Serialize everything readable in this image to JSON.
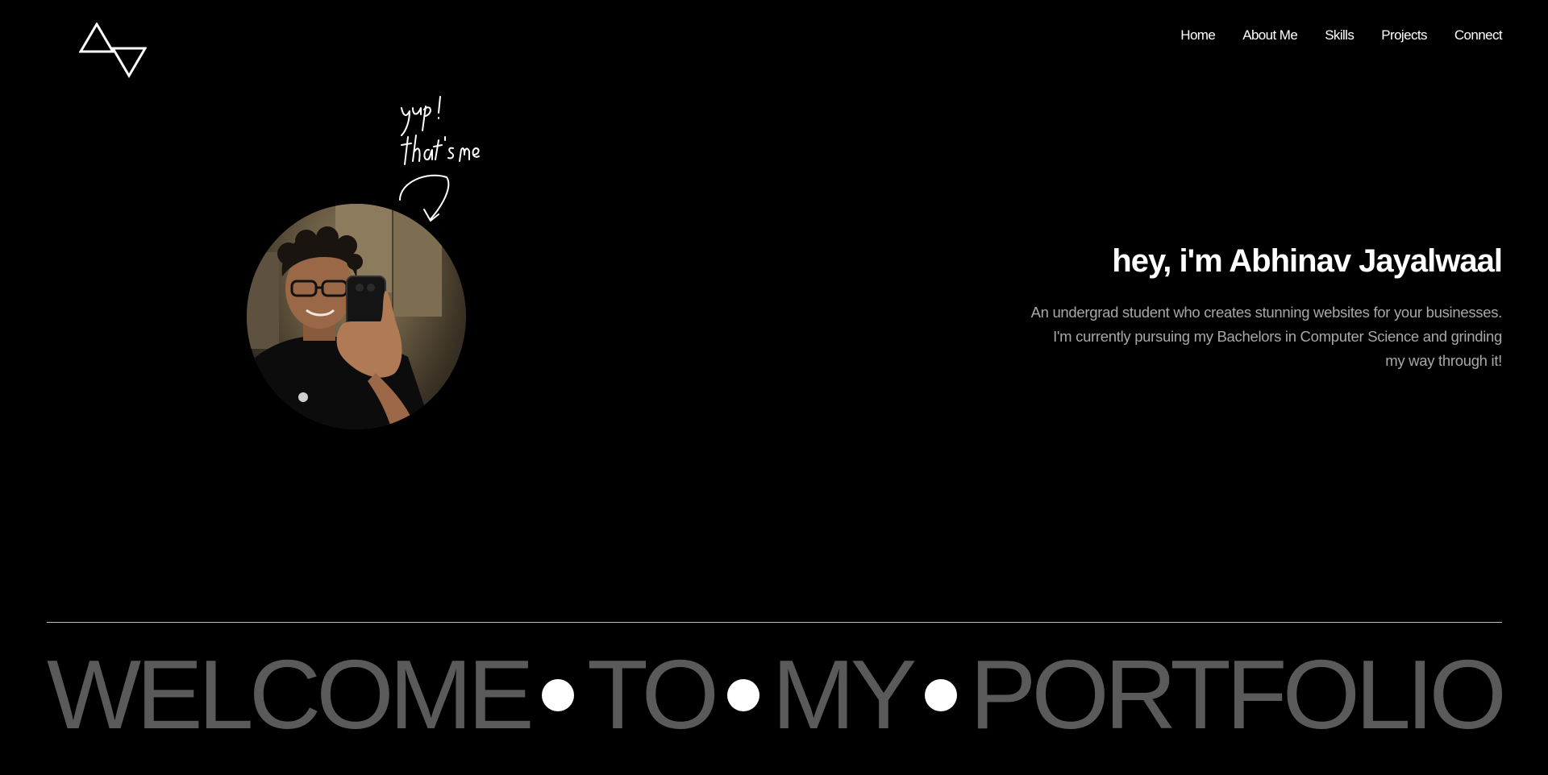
{
  "nav": {
    "items": [
      {
        "label": "Home"
      },
      {
        "label": "About Me"
      },
      {
        "label": "Skills"
      },
      {
        "label": "Projects"
      },
      {
        "label": "Connect"
      }
    ]
  },
  "note": {
    "handwritten_text": "yup! that's me"
  },
  "hero": {
    "title": "hey, i'm Abhinav Jayalwaal",
    "description_line1": "An undergrad student who creates stunning websites for your businesses.",
    "description_line2": "I'm currently pursuing my Bachelors in Computer Science and grinding",
    "description_line3": "my way through it!"
  },
  "marquee": {
    "words": [
      "WELCOME",
      "TO",
      "MY",
      "PORTFOLIO"
    ]
  },
  "colors": {
    "background": "#000000",
    "text": "#ffffff",
    "muted_text": "#a8a8a8",
    "marquee_text": "#5a5a5a"
  }
}
